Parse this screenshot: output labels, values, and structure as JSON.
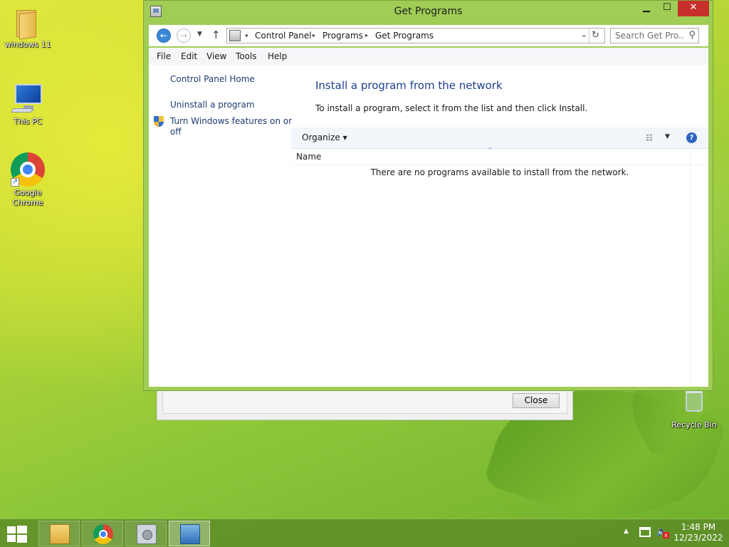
{
  "desktop": {
    "icons": [
      {
        "label": "windows 11"
      },
      {
        "label": "This PC"
      },
      {
        "label": "Google Chrome"
      },
      {
        "label": "Recycle Bin"
      }
    ]
  },
  "back_dialog": {
    "close_label": "Close"
  },
  "window": {
    "title": "Get Programs",
    "controls": {
      "minimize": "▁",
      "maximize": "☐",
      "close": "✕"
    },
    "nav": {
      "back": "←",
      "forward": "→",
      "recent": "▼",
      "up": "↑",
      "breadcrumbs": [
        "Control Panel",
        "Programs",
        "Get Programs"
      ],
      "breadcrumb_sep": "▸",
      "address_dropdown": "⌄",
      "refresh": "↻",
      "search_placeholder": "Search Get Pro...",
      "search_glyph": "⚲"
    },
    "menu": [
      "File",
      "Edit",
      "View",
      "Tools",
      "Help"
    ],
    "sidebar": {
      "home": "Control Panel Home",
      "uninstall": "Uninstall a program",
      "features_line1": "Turn Windows features on or",
      "features_line2": "off"
    },
    "content": {
      "title": "Install a program from the network",
      "description": "To install a program, select it from the list and then click Install.",
      "toolbar": {
        "organize": "Organize ▾",
        "view_glyph": "☷",
        "view_dropdown": "▼",
        "help_glyph": "?"
      },
      "column_name": "Name",
      "sort_glyph": "^",
      "empty_message": "There are no programs available to install from the network."
    }
  },
  "taskbar": {
    "tray_overflow": "▲",
    "volume_glyph": "🔈",
    "mute_glyph": "x",
    "time": "1:48 PM",
    "date": "12/23/2022"
  },
  "colors": {
    "window_frame": "#9fcd55",
    "close_button": "#c7302a",
    "link_text": "#1e3b72",
    "heading_text": "#1e3f8c"
  }
}
